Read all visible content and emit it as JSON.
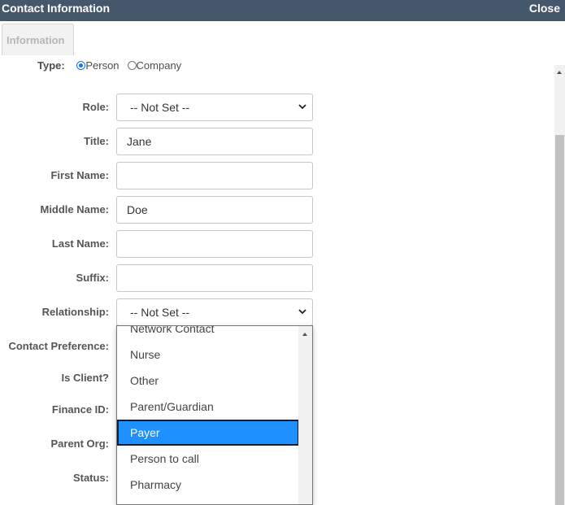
{
  "window": {
    "title": "Contact Information",
    "close_label": "Close"
  },
  "tabs": [
    {
      "label": "Information"
    }
  ],
  "type_field": {
    "label": "Type:",
    "options": [
      "Person",
      "Company"
    ],
    "selected": "Person"
  },
  "fields": {
    "role": {
      "label": "Role:",
      "value": "-- Not Set --"
    },
    "title": {
      "label": "Title:",
      "value": "Jane"
    },
    "first_name": {
      "label": "First Name:",
      "value": ""
    },
    "middle_name": {
      "label": "Middle Name:",
      "value": "Doe"
    },
    "last_name": {
      "label": "Last Name:",
      "value": ""
    },
    "suffix": {
      "label": "Suffix:",
      "value": ""
    },
    "relationship": {
      "label": "Relationship:",
      "value": "-- Not Set --"
    },
    "contact_preference": {
      "label": "Contact Preference:"
    },
    "is_client": {
      "label": "Is Client?"
    },
    "finance_id": {
      "label": "Finance ID:"
    },
    "parent_org": {
      "label": "Parent Org:"
    },
    "status": {
      "label": "Status:"
    }
  },
  "relationship_dropdown": {
    "items": [
      "Network Contact",
      "Nurse",
      "Other",
      "Parent/Guardian",
      "Payer",
      "Person to call",
      "Pharmacy",
      ""
    ],
    "highlighted": "Payer"
  },
  "colors": {
    "titlebar": "#44576b",
    "highlight": "#1e90ff"
  },
  "icons": [
    "chevron-down-icon",
    "scroll-up-arrow-icon",
    "radio-icon"
  ]
}
